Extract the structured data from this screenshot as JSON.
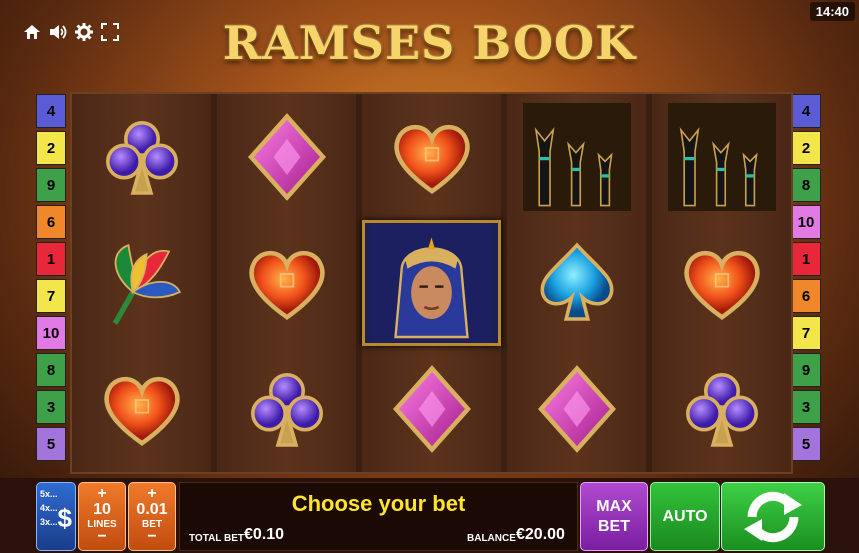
{
  "game": {
    "title": "RAMSES BOOK",
    "time": "14:40"
  },
  "toolbar_icons": [
    "home-icon",
    "sound-icon",
    "settings-icon",
    "fullscreen-icon"
  ],
  "reels": [
    [
      "club",
      "lotus",
      "heart"
    ],
    [
      "diamond",
      "heart",
      "club"
    ],
    [
      "heart",
      "pharaoh",
      "diamond"
    ],
    [
      "cats",
      "spade",
      "diamond"
    ],
    [
      "cats",
      "heart",
      "club"
    ]
  ],
  "lines_left": [
    {
      "n": "4",
      "color": "#5b5bd6"
    },
    {
      "n": "2",
      "color": "#f2e64a"
    },
    {
      "n": "9",
      "color": "#3fa04a"
    },
    {
      "n": "6",
      "color": "#f0872a"
    },
    {
      "n": "1",
      "color": "#e8283a"
    },
    {
      "n": "7",
      "color": "#f2e64a"
    },
    {
      "n": "10",
      "color": "#e27ae6"
    },
    {
      "n": "8",
      "color": "#3fa04a"
    },
    {
      "n": "3",
      "color": "#3fa04a"
    },
    {
      "n": "5",
      "color": "#a374db"
    }
  ],
  "lines_right": [
    {
      "n": "4",
      "color": "#5b5bd6"
    },
    {
      "n": "2",
      "color": "#f2e64a"
    },
    {
      "n": "8",
      "color": "#3fa04a"
    },
    {
      "n": "10",
      "color": "#e27ae6"
    },
    {
      "n": "1",
      "color": "#e8283a"
    },
    {
      "n": "6",
      "color": "#f0872a"
    },
    {
      "n": "7",
      "color": "#f2e64a"
    },
    {
      "n": "9",
      "color": "#3fa04a"
    },
    {
      "n": "3",
      "color": "#3fa04a"
    },
    {
      "n": "5",
      "color": "#a374db"
    }
  ],
  "bottom": {
    "coin_multipliers": [
      "5x...",
      "4x...",
      "3x..."
    ],
    "coin_symbol": "$",
    "lines": {
      "plus": "+",
      "value": "10",
      "label": "LINES",
      "minus": "−"
    },
    "bet": {
      "plus": "+",
      "value": "0.01",
      "label": "BET",
      "minus": "−"
    },
    "message": "Choose your bet",
    "total_bet_label": "TOTAL BET",
    "total_bet_value": "€0.10",
    "balance_label": "BALANCE",
    "balance_value": "€20.00",
    "max_bet_line1": "MAX",
    "max_bet_line2": "BET",
    "auto_label": "AUTO"
  }
}
